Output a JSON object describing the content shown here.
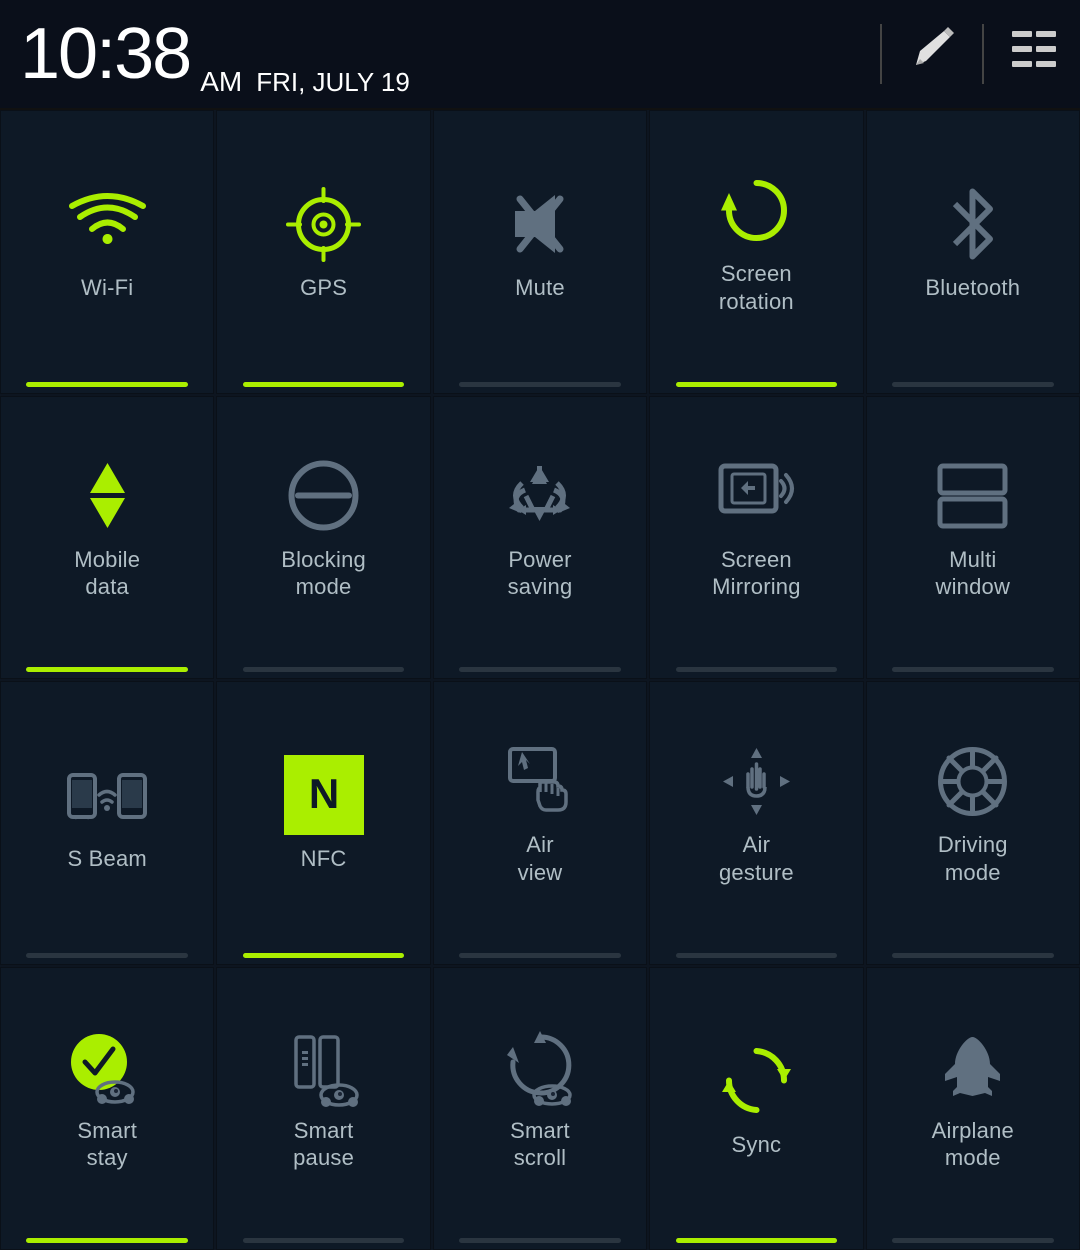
{
  "statusBar": {
    "time": "10:38",
    "ampm": "AM",
    "date": "FRI, JULY 19",
    "editIcon": "✏",
    "menuIcon": "≡"
  },
  "tiles": [
    {
      "id": "wifi",
      "label": "Wi-Fi",
      "active": true,
      "icon": "wifi"
    },
    {
      "id": "gps",
      "label": "GPS",
      "active": true,
      "icon": "gps"
    },
    {
      "id": "mute",
      "label": "Mute",
      "active": false,
      "icon": "mute"
    },
    {
      "id": "screenrotation",
      "label": "Screen\nrotation",
      "active": true,
      "icon": "rotation"
    },
    {
      "id": "bluetooth",
      "label": "Bluetooth",
      "active": false,
      "icon": "bluetooth"
    },
    {
      "id": "mobiledata",
      "label": "Mobile\ndata",
      "active": true,
      "icon": "mobiledata"
    },
    {
      "id": "blockingmode",
      "label": "Blocking\nmode",
      "active": false,
      "icon": "blocking"
    },
    {
      "id": "powersaving",
      "label": "Power\nsaving",
      "active": false,
      "icon": "powersaving"
    },
    {
      "id": "screenmirroring",
      "label": "Screen\nMirroring",
      "active": false,
      "icon": "screenmirroring"
    },
    {
      "id": "multiwindow",
      "label": "Multi\nwindow",
      "active": false,
      "icon": "multiwindow"
    },
    {
      "id": "sbeam",
      "label": "S Beam",
      "active": false,
      "icon": "sbeam"
    },
    {
      "id": "nfc",
      "label": "NFC",
      "active": true,
      "icon": "nfc"
    },
    {
      "id": "airview",
      "label": "Air\nview",
      "active": false,
      "icon": "airview"
    },
    {
      "id": "airgesture",
      "label": "Air\ngesture",
      "active": false,
      "icon": "airgesture"
    },
    {
      "id": "drivingmode",
      "label": "Driving\nmode",
      "active": false,
      "icon": "driving"
    },
    {
      "id": "smartstay",
      "label": "Smart\nstay",
      "active": true,
      "icon": "smartstay"
    },
    {
      "id": "smartpause",
      "label": "Smart\npause",
      "active": false,
      "icon": "smartpause"
    },
    {
      "id": "smartscroll",
      "label": "Smart\nscroll",
      "active": false,
      "icon": "smartscroll"
    },
    {
      "id": "sync",
      "label": "Sync",
      "active": true,
      "icon": "sync"
    },
    {
      "id": "airplanemode",
      "label": "Airplane\nmode",
      "active": false,
      "icon": "airplane"
    }
  ]
}
